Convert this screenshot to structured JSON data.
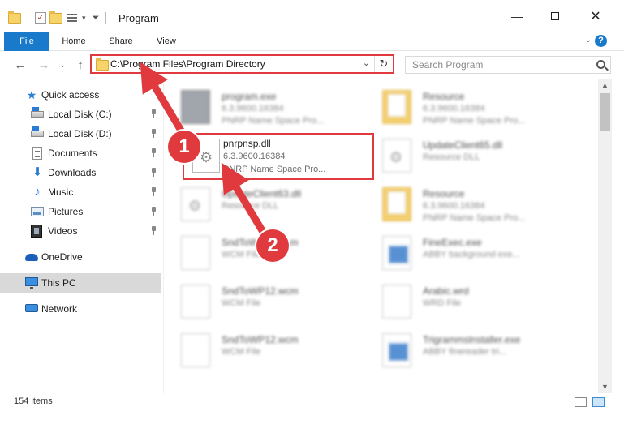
{
  "window": {
    "title": "Program",
    "minimize_icon": "minimize-icon",
    "maximize_icon": "maximize-icon",
    "close_icon": "close-icon"
  },
  "ribbon": {
    "tabs": [
      "File",
      "Home",
      "Share",
      "View"
    ],
    "help": "?"
  },
  "nav": {
    "address": "C:\\Program Files\\Program Directory",
    "search_placeholder": "Search Program"
  },
  "sidebar": {
    "quick_access": "Quick access",
    "pinned": [
      {
        "label": "Local Disk (C:)",
        "icon": "drive-icon"
      },
      {
        "label": "Local Disk (D:)",
        "icon": "drive-icon"
      },
      {
        "label": "Documents",
        "icon": "documents-icon"
      },
      {
        "label": "Downloads",
        "icon": "downloads-icon"
      },
      {
        "label": "Music",
        "icon": "music-icon"
      },
      {
        "label": "Pictures",
        "icon": "pictures-icon"
      },
      {
        "label": "Videos",
        "icon": "videos-icon"
      }
    ],
    "onedrive": "OneDrive",
    "this_pc": "This PC",
    "network": "Network"
  },
  "files": [
    {
      "name": "program.exe",
      "version": "6.3.9600.16384",
      "desc": "PNRP Name Space Pro...",
      "icon": "exe-icon"
    },
    {
      "name": "Resource",
      "version": "6.3.9600.16384",
      "desc": "PNRP Name Space Pro...",
      "icon": "folder-icon"
    },
    {
      "name": "pnrpnsp.dll",
      "version": "6.3.9600.16384",
      "desc": "PNRP Name Space Pro...",
      "icon": "dll-icon"
    },
    {
      "name": "UpdateClient65.dll",
      "version": "Resource DLL",
      "desc": "",
      "icon": "dll-icon"
    },
    {
      "name": "UpdateClient63.dll",
      "version": "Resource DLL",
      "desc": "",
      "icon": "dll-icon"
    },
    {
      "name": "Resource",
      "version": "6.3.9600.16384",
      "desc": "PNRP Name Space Pro...",
      "icon": "folder-icon"
    },
    {
      "name": "SndToWP12.wcm",
      "version": "WCM File",
      "desc": "",
      "icon": "file-icon"
    },
    {
      "name": "FineExec.exe",
      "version": "ABBY background exe...",
      "desc": "",
      "icon": "app-icon"
    },
    {
      "name": "SndToWP12.wcm",
      "version": "WCM File",
      "desc": "",
      "icon": "file-icon"
    },
    {
      "name": "Arabic.wrd",
      "version": "WRD File",
      "desc": "",
      "icon": "file-icon"
    },
    {
      "name": "SndToWP12.wcm",
      "version": "WCM File",
      "desc": "",
      "icon": "file-icon"
    },
    {
      "name": "Trigrammslnstaller.exe",
      "version": "ABBY finereader tri...",
      "desc": "",
      "icon": "app-icon"
    }
  ],
  "status": {
    "item_count": "154 items"
  },
  "annotations": {
    "step1": "1",
    "step2": "2",
    "color": "#e03a3e"
  }
}
